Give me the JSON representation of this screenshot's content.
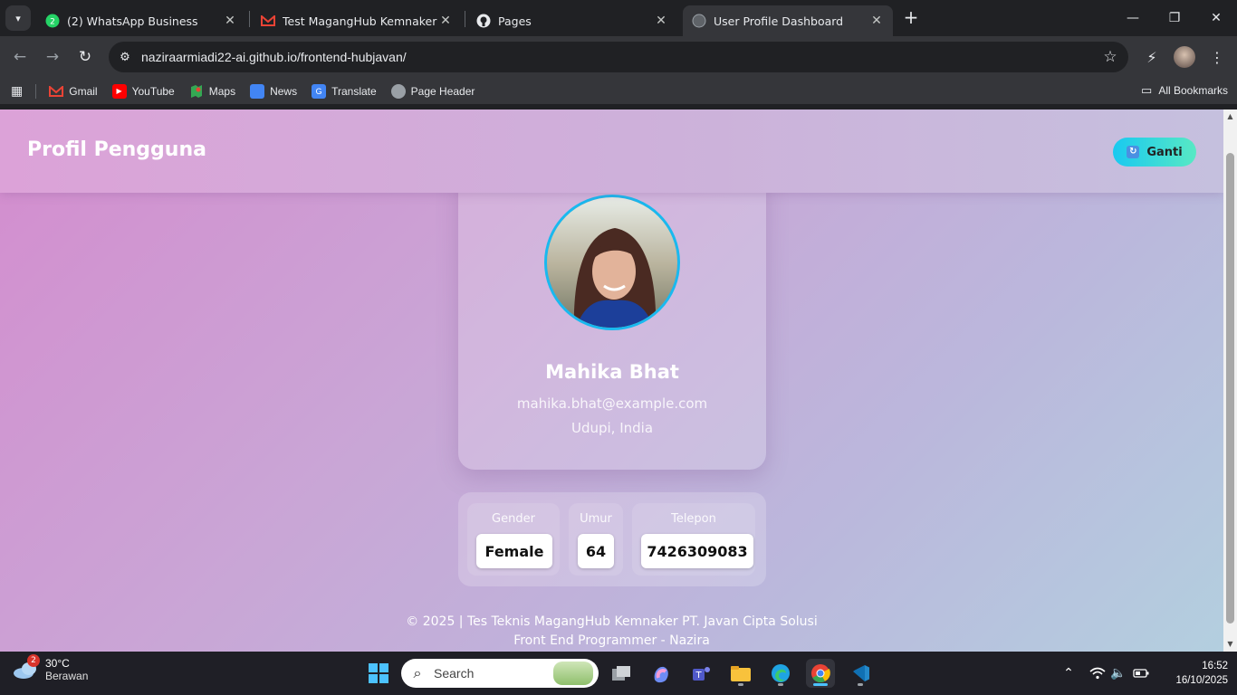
{
  "browser": {
    "tabs": [
      {
        "title": "(2) WhatsApp Business",
        "icon": "whatsapp-icon"
      },
      {
        "title": "Test MagangHub Kemnaker PT.",
        "icon": "gmail-icon"
      },
      {
        "title": "Pages",
        "icon": "github-icon"
      },
      {
        "title": "User Profile Dashboard",
        "icon": "globe-icon",
        "active": true
      }
    ],
    "url": "naziraarmiadi22-ai.github.io/frontend-hubjavan/",
    "bookmarks": [
      {
        "label": "Gmail",
        "icon": "gmail-icon"
      },
      {
        "label": "YouTube",
        "icon": "youtube-icon"
      },
      {
        "label": "Maps",
        "icon": "maps-icon"
      },
      {
        "label": "News",
        "icon": "news-icon"
      },
      {
        "label": "Translate",
        "icon": "translate-icon"
      },
      {
        "label": "Page Header",
        "icon": "globe-icon"
      }
    ],
    "all_bookmarks": "All Bookmarks"
  },
  "page": {
    "header_title": "Profil Pengguna",
    "switch_button": "Ganti",
    "profile": {
      "name": "Mahika Bhat",
      "email": "mahika.bhat@example.com",
      "location": "Udupi, India"
    },
    "info": [
      {
        "label": "Gender",
        "value": "Female"
      },
      {
        "label": "Umur",
        "value": "64"
      },
      {
        "label": "Telepon",
        "value": "7426309083"
      }
    ],
    "footer_line1": "© 2025 | Tes Teknis MagangHub Kemnaker PT. Javan Cipta Solusi",
    "footer_line2": "Front End Programmer - Nazira"
  },
  "taskbar": {
    "weather_temp": "30°C",
    "weather_desc": "Berawan",
    "weather_badge": "2",
    "search_placeholder": "Search",
    "time": "16:52",
    "date": "16/10/2025"
  },
  "colors": {
    "accent_gradient_start": "#19c9f0",
    "accent_gradient_end": "#58e9c4",
    "avatar_ring": "#19b9ef"
  }
}
